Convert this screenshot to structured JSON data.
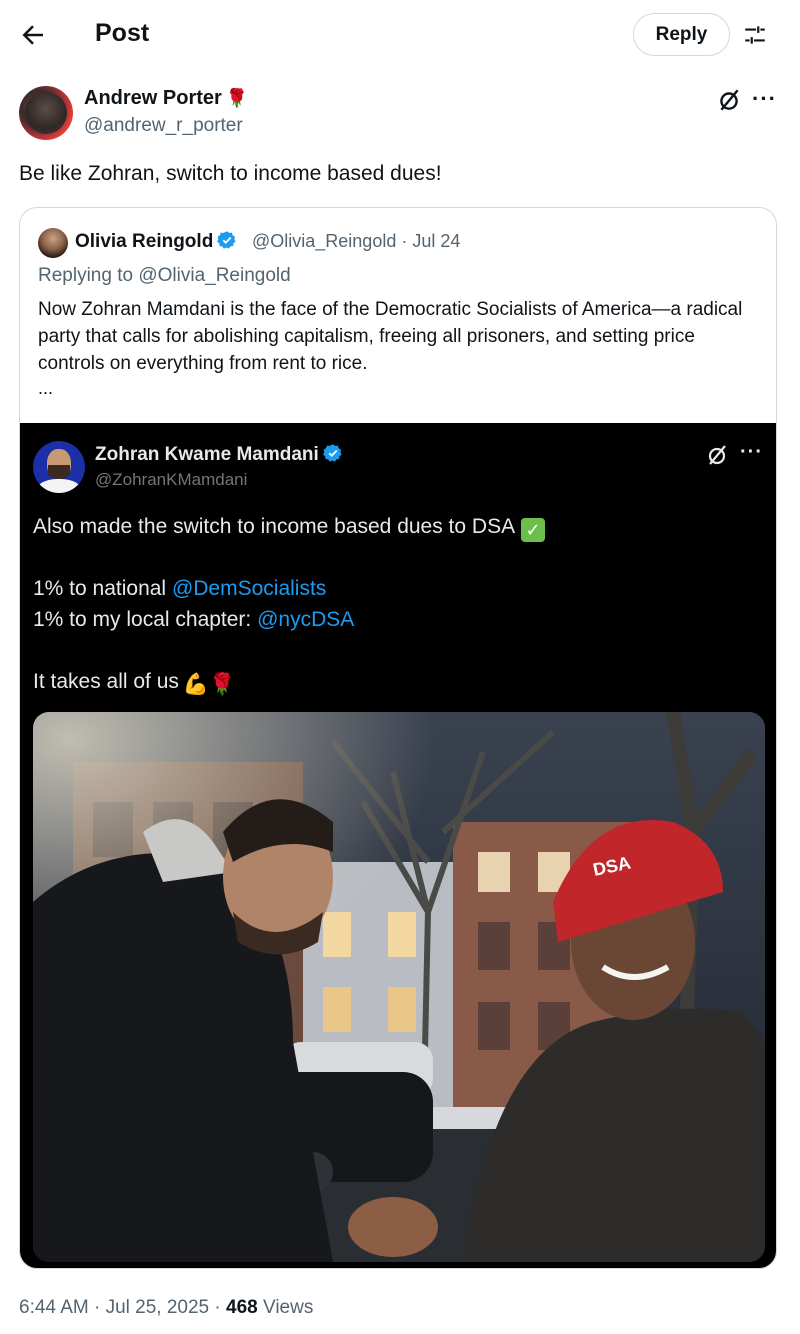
{
  "header": {
    "title": "Post",
    "reply_label": "Reply",
    "back_icon": "back-arrow-icon",
    "settings_icon": "sliders-icon"
  },
  "post": {
    "author_name": "Andrew Porter",
    "author_badge": "🌹",
    "author_handle": "@andrew_r_porter",
    "text": "Be like Zohran, switch to income based dues!",
    "timestamp": "6:44 AM · Jul 25, 2025 · ",
    "views_count": "468",
    "views_label": " Views"
  },
  "quote": {
    "name": "Olivia Reingold",
    "handle_date": "@Olivia_Reingold · Jul 24",
    "replying": "Replying to @Olivia_Reingold",
    "body": "Now Zohran Mamdani is the face of the Democratic Socialists of America—a radical party that calls for abolishing capitalism, freeing all prisoners, and setting price controls on everything from rent to rice.",
    "ellipsis": "...",
    "embed": {
      "name": "Zohran Kwame Mamdani",
      "handle": "@ZohranKMamdani",
      "line1": "Also made the switch to income based dues to DSA",
      "line2_prefix": "1% to national ",
      "line2_link": "@DemSocialists",
      "line3_prefix": "1% to my local chapter: ",
      "line3_link": "@nycDSA",
      "line4": "It takes all of us",
      "line4_emojis": "💪🌹",
      "hat_text": "DSA"
    }
  },
  "colors": {
    "link": "#1d9bf0",
    "verified": "#1d9bf0",
    "secondary_text": "#536471"
  }
}
